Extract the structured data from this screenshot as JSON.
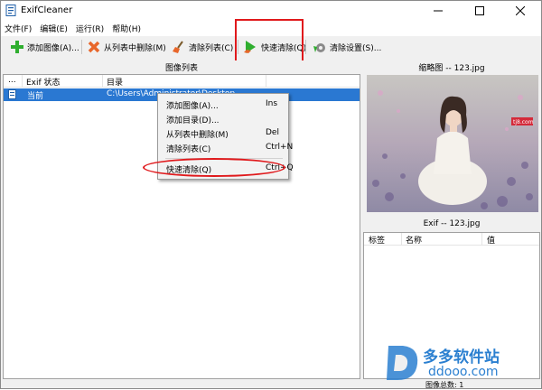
{
  "window": {
    "title": "ExifCleaner"
  },
  "menu": [
    "文件(F)",
    "编辑(E)",
    "运行(R)",
    "帮助(H)"
  ],
  "toolbar": {
    "add_image": "添加图像(A)...",
    "remove_from_list": "从列表中删除(M)",
    "clear_list": "清除列表(C)",
    "quick_clean": "快速清除(Q)",
    "clean_settings": "清除设置(S)..."
  },
  "image_list": {
    "header": "图像列表",
    "columns": [
      "...",
      "Exif 状态",
      "目录"
    ],
    "rows": [
      {
        "status": "当前",
        "path": "C:\\Users\\Administrator\\Desktop"
      }
    ]
  },
  "thumbnail": {
    "header": "缩略图 -- 123.jpg",
    "watermark_text": "tj8.com"
  },
  "exif": {
    "header": "Exif -- 123.jpg",
    "columns": [
      "标签",
      "名称",
      "值"
    ]
  },
  "status": {
    "text": "图像总数: 1"
  },
  "context_menu": [
    {
      "label": "添加图像(A)...",
      "key": "Ins"
    },
    {
      "label": "添加目录(D)...",
      "key": ""
    },
    {
      "label": "从列表中删除(M)",
      "key": "Del"
    },
    {
      "label": "清除列表(C)",
      "key": "Ctrl+N"
    },
    {
      "label": "快速清除(Q)",
      "key": "Ctrl+Q"
    }
  ],
  "watermark": {
    "line1": "多多软件站",
    "line2": "ddooo.com"
  },
  "colors": {
    "selection": "#2a78d2",
    "highlight": "#e0191c",
    "watermark": "#2a7fd0"
  }
}
